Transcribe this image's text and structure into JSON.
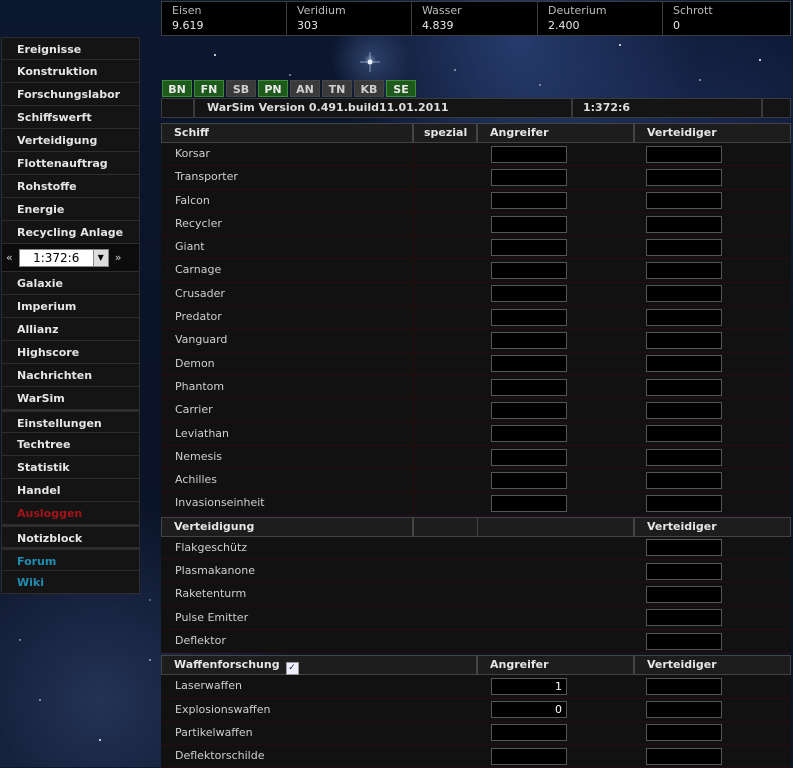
{
  "resources": [
    {
      "name": "Eisen",
      "value": "9.619"
    },
    {
      "name": "Veridium",
      "value": "303"
    },
    {
      "name": "Wasser",
      "value": "4.839"
    },
    {
      "name": "Deuterium",
      "value": "2.400"
    },
    {
      "name": "Schrott",
      "value": "0"
    }
  ],
  "sidebar": {
    "group1": [
      "Ereignisse",
      "Konstruktion",
      "Forschungslabor",
      "Schiffswerft",
      "Verteidigung",
      "Flottenauftrag",
      "Rohstoffe",
      "Energie",
      "Recycling Anlage"
    ],
    "planet": {
      "prev": "«",
      "value": "1:372:6",
      "next": "»"
    },
    "group2": [
      "Galaxie",
      "Imperium",
      "Allianz",
      "Highscore",
      "Nachrichten",
      "WarSim"
    ],
    "group3": [
      "Einstellungen",
      "Techtree",
      "Statistik",
      "Handel"
    ],
    "logout": "Ausloggen",
    "notes": "Notizblock",
    "forum": "Forum",
    "wiki": "Wiki"
  },
  "tabs": [
    "BN",
    "FN",
    "SB",
    "PN",
    "AN",
    "TN",
    "KB",
    "SE"
  ],
  "version": {
    "text": "WarSim Version 0.491.build11.01.2011",
    "coords": "1:372:6"
  },
  "ships": {
    "header": {
      "name": "Schiff",
      "special": "spezial",
      "attacker": "Angreifer",
      "defender": "Verteidiger"
    },
    "rows": [
      "Korsar",
      "Transporter",
      "Falcon",
      "Recycler",
      "Giant",
      "Carnage",
      "Crusader",
      "Predator",
      "Vanguard",
      "Demon",
      "Phantom",
      "Carrier",
      "Leviathan",
      "Nemesis",
      "Achilles",
      "Invasionseinheit"
    ]
  },
  "defense": {
    "header": {
      "name": "Verteidigung",
      "defender": "Verteidiger"
    },
    "rows": [
      "Flakgeschütz",
      "Plasmakanone",
      "Raketenturm",
      "Pulse Emitter",
      "Deflektor"
    ]
  },
  "weapons": {
    "header": {
      "name": "Waffenforschung",
      "attacker": "Angreifer",
      "defender": "Verteidiger",
      "check": "✓"
    },
    "rows": [
      {
        "name": "Laserwaffen",
        "attacker": "1"
      },
      {
        "name": "Explosionswaffen",
        "attacker": "0"
      },
      {
        "name": "Partikelwaffen",
        "attacker": ""
      },
      {
        "name": "Deflektorschilde",
        "attacker": ""
      }
    ]
  }
}
